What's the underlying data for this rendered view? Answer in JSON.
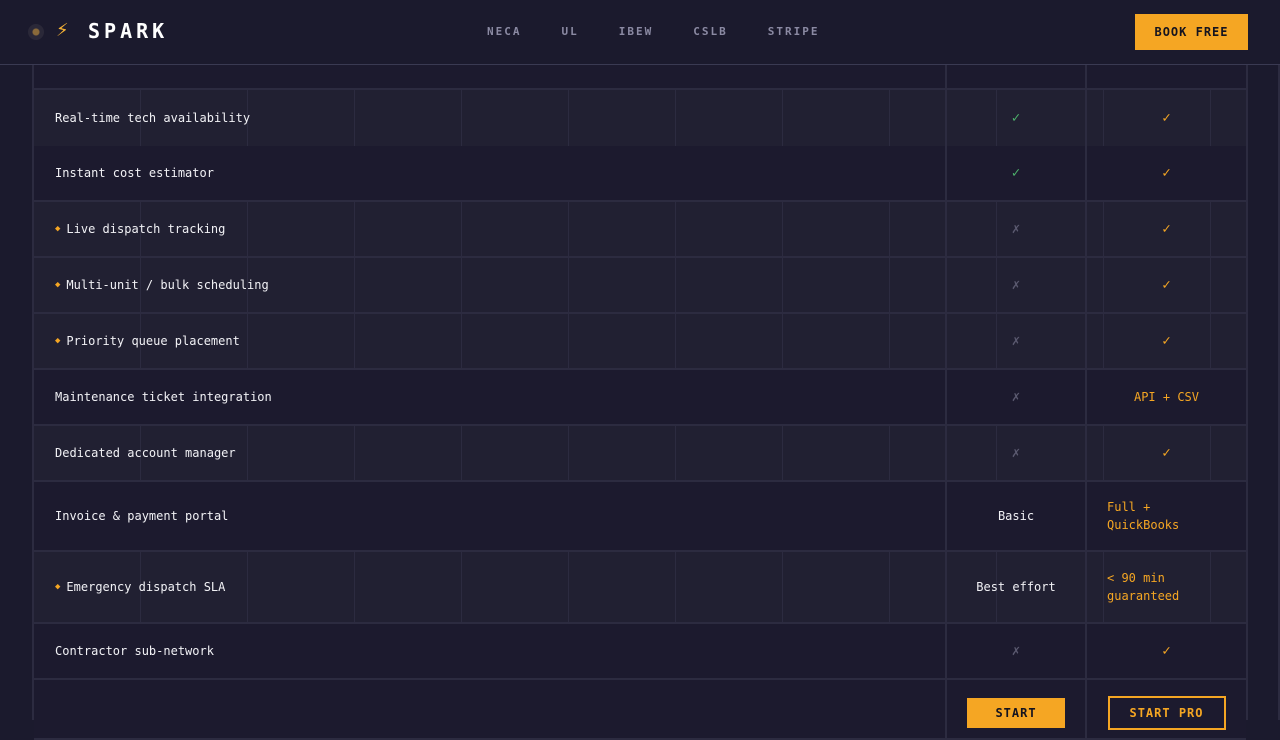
{
  "header": {
    "brand": "SPARK",
    "links": [
      "NECA",
      "UL",
      "IBEW",
      "CSLB",
      "STRIPE"
    ],
    "book_label": "BOOK FREE"
  },
  "table": {
    "rows": [
      {
        "feature": "Real-time tech availability",
        "highlight": false,
        "basic": {
          "kind": "check"
        },
        "pro": {
          "kind": "check"
        }
      },
      {
        "feature": "Instant cost estimator",
        "highlight": false,
        "basic": {
          "kind": "check"
        },
        "pro": {
          "kind": "check"
        }
      },
      {
        "feature": "Live dispatch tracking",
        "highlight": true,
        "basic": {
          "kind": "cross"
        },
        "pro": {
          "kind": "check"
        }
      },
      {
        "feature": "Multi-unit / bulk scheduling",
        "highlight": true,
        "basic": {
          "kind": "cross"
        },
        "pro": {
          "kind": "check"
        }
      },
      {
        "feature": "Priority queue placement",
        "highlight": true,
        "basic": {
          "kind": "cross"
        },
        "pro": {
          "kind": "check"
        }
      },
      {
        "feature": "Maintenance ticket integration",
        "highlight": false,
        "basic": {
          "kind": "cross"
        },
        "pro": {
          "kind": "text",
          "text": "API + CSV"
        }
      },
      {
        "feature": "Dedicated account manager",
        "highlight": false,
        "basic": {
          "kind": "cross"
        },
        "pro": {
          "kind": "check"
        }
      },
      {
        "feature": "Invoice & payment portal",
        "highlight": false,
        "basic": {
          "kind": "text",
          "text": "Basic"
        },
        "pro": {
          "kind": "text",
          "text": "Full + QuickBooks"
        }
      },
      {
        "feature": "Emergency dispatch SLA",
        "highlight": true,
        "basic": {
          "kind": "text",
          "text": "Best effort"
        },
        "pro": {
          "kind": "text",
          "text": "< 90 min guaranteed"
        }
      },
      {
        "feature": "Contractor sub-network",
        "highlight": false,
        "basic": {
          "kind": "cross"
        },
        "pro": {
          "kind": "check"
        }
      }
    ],
    "actions": {
      "start_label": "START",
      "start_pro_label": "START PRO"
    }
  },
  "icons": {
    "check": "✓",
    "cross": "✗",
    "diamond": "◆",
    "bolt": "⚡"
  },
  "colors": {
    "accent": "#f5a623",
    "check_basic": "#4caf6a",
    "background": "#1b1a2d"
  }
}
